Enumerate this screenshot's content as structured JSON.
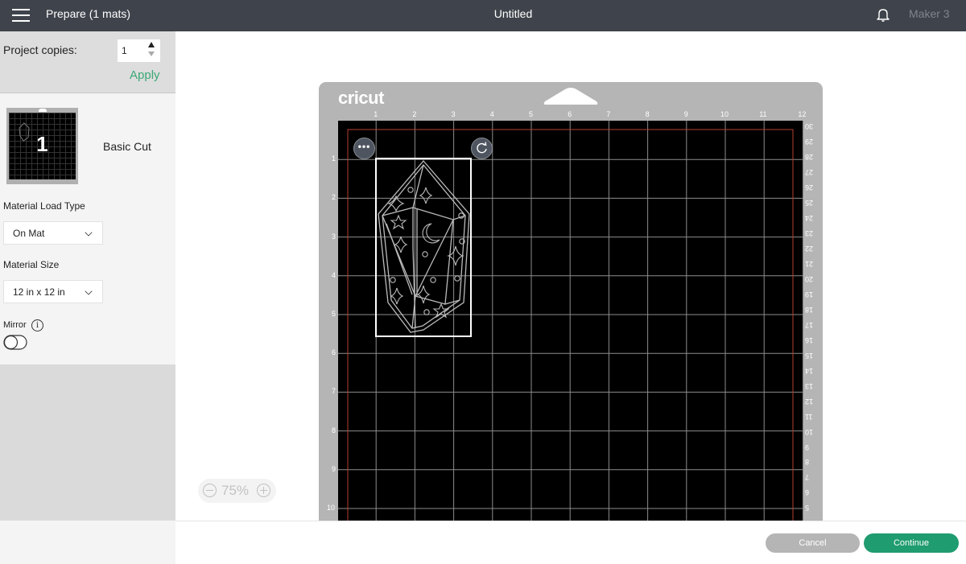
{
  "header": {
    "menu_icon": "hamburger-menu-icon",
    "title": "Prepare (1 mats)",
    "document_title": "Untitled",
    "notification_icon": "bell-icon",
    "machine": "Maker 3"
  },
  "left_panel": {
    "project_copies_label": "Project copies:",
    "project_copies_value": "1",
    "apply_label": "Apply",
    "mats": [
      {
        "number": "1",
        "name": "Basic Cut"
      }
    ],
    "material_load_type_label": "Material Load Type",
    "material_load_type_value": "On Mat",
    "material_size_label": "Material Size",
    "material_size_value": "12 in x 12 in",
    "mirror_label": "Mirror",
    "mirror_enabled": false,
    "info_icon_glyph": "i"
  },
  "canvas": {
    "brand": "cricut",
    "ruler_top": [
      "1",
      "2",
      "3",
      "4",
      "5",
      "6",
      "7",
      "8",
      "9",
      "10",
      "11",
      "12"
    ],
    "ruler_left": [
      "1",
      "2",
      "3",
      "4",
      "5",
      "6",
      "7",
      "8",
      "9",
      "10"
    ],
    "ruler_right_cm": [
      "30",
      "29",
      "28",
      "27",
      "26",
      "25",
      "24",
      "23",
      "22",
      "21",
      "20",
      "19",
      "18",
      "17",
      "16",
      "15",
      "14",
      "13",
      "12",
      "11",
      "10",
      "9",
      "8",
      "7",
      "6",
      "5"
    ],
    "more_options_glyph": "•••",
    "zoom_level": "75%"
  },
  "footer": {
    "cancel_label": "Cancel",
    "continue_label": "Continue"
  },
  "colors": {
    "header_bg": "#3f434b",
    "accent_green": "#1f9c70",
    "apply_green": "#3aa876",
    "mat_gray": "#b5b5b5",
    "cut_margin_red": "#b5412f"
  }
}
